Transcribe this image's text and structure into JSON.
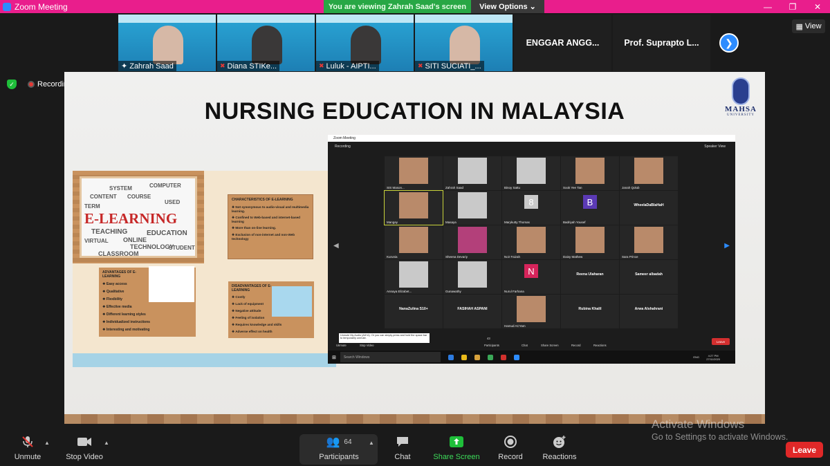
{
  "window": {
    "title": "Zoom Meeting",
    "banner": "You are viewing Zahrah Saad's screen",
    "view_options": "View Options",
    "view_button": "View"
  },
  "thumbnails": [
    {
      "name": "Zahrah Saad",
      "muted": false
    },
    {
      "name": "Diana  STIKe...",
      "muted": true
    },
    {
      "name": "Luluk - AIPTI...",
      "muted": true
    },
    {
      "name": "SITI SUCIATI_...",
      "muted": true
    }
  ],
  "name_tiles": [
    "ENGGAR ANGG...",
    "Prof. Suprapto L..."
  ],
  "recording": "Recording",
  "slide": {
    "title": "NURSING EDUCATION IN MALAYSIA",
    "logo_text": "MAHSA",
    "logo_sub": "UNIVERSITY",
    "elearning": "E-LEARNING",
    "wordcloud_words": [
      "ONLINE",
      "TEACHING",
      "EDUCATION",
      "TECHNOLOGY",
      "CLASSROOM",
      "USED",
      "STUDENT",
      "COURSE",
      "VIRTUAL",
      "SYSTEM",
      "COMPUTER",
      "TERM",
      "CONTENT"
    ],
    "characteristics": {
      "heading": "CHARACTERISTICS OF E-LEARNING",
      "items": [
        "Not synonymous to audio-visual and multimedia learning.",
        "Confined to Web-based and internet-based learning",
        "More than on-line learning.",
        "Exclusion of non-internet and non-Web technology"
      ]
    },
    "advantages": {
      "heading": "ADVANTAGES OF E-LEARNING",
      "items": [
        "Easy access",
        "Qualitative",
        "Flexibility",
        "Effective media",
        "Different learning styles",
        "Individualized instructions",
        "Interesting and motivating"
      ]
    },
    "disadvantages": {
      "heading": "DISADVANTAGES OF E-LEARNING",
      "items": [
        "Costly",
        "Lack of equipment",
        "Negative attitude",
        "Feeling of isolation",
        "Requires knowledge and skills",
        "Adverse effect on health"
      ]
    }
  },
  "inner_zoom": {
    "title": "Zoom Meeting",
    "recording": "Recording",
    "speaker_view": "Speaker View",
    "participants": [
      {
        "name": "SIS Mason...",
        "kind": "video",
        "tone": "warm"
      },
      {
        "name": "Zahrah Saad",
        "kind": "video",
        "tone": "lt"
      },
      {
        "name": "Binoy Sattu",
        "kind": "video",
        "tone": "lt"
      },
      {
        "name": "Sook Yee Tan",
        "kind": "video",
        "tone": "warm"
      },
      {
        "name": "Janah Qolub",
        "kind": "video",
        "tone": "warm"
      },
      {
        "name": "Mangay",
        "kind": "video",
        "tone": "warm",
        "selected": true
      },
      {
        "name": "Masaya",
        "kind": "video",
        "tone": "lt"
      },
      {
        "name": "Marykutty Thomas",
        "kind": "avatar",
        "letter": "8",
        "color": "#c9c9c9"
      },
      {
        "name": "Badriyah Yousef",
        "kind": "avatar",
        "letter": "B",
        "color": "#5b3ab5"
      },
      {
        "name": "WheelaDaBlaHaH",
        "kind": "name"
      },
      {
        "name": "Kurunia",
        "kind": "video",
        "tone": "warm"
      },
      {
        "name": "Sheena Devariy",
        "kind": "video",
        "tone": "mag"
      },
      {
        "name": "Noir Faizah",
        "kind": "video",
        "tone": "warm"
      },
      {
        "name": "Daisy Mathew",
        "kind": "video",
        "tone": "warm"
      },
      {
        "name": "Sara Prince",
        "kind": "video",
        "tone": "warm"
      },
      {
        "name": "Annaya Elizabet...",
        "kind": "video",
        "tone": "lt"
      },
      {
        "name": "Gunawathy",
        "kind": "video",
        "tone": "lt"
      },
      {
        "name": "Nurul Farhana",
        "kind": "avatar",
        "letter": "N",
        "color": "#d6245b"
      },
      {
        "name": "Reena Ulaharan",
        "kind": "name"
      },
      {
        "name": "Sameer albadah",
        "kind": "name"
      },
      {
        "name": "NanaZulina S10+",
        "kind": "name"
      },
      {
        "name": "FASIHAH ASPANI",
        "kind": "name"
      },
      {
        "name": "Hamud ACYam",
        "kind": "video",
        "tone": "warm"
      },
      {
        "name": "Rubina Khalil",
        "kind": "name"
      },
      {
        "name": "Arwa Alshahrani",
        "kind": "name"
      }
    ],
    "tooltip": "Unmute My Audio (Alt+A). Or you can simply press and hold the space bar to temporarily unmute.",
    "controls": [
      "Unmute",
      "Stop Video",
      "Participants",
      "Chat",
      "Share Screen",
      "Record",
      "Reactions"
    ],
    "participants_count": "43",
    "leave": "Leave",
    "taskbar_search": "Search Windows",
    "clock_time": "4:27 PM",
    "clock_date": "27/11/2020",
    "lang": "ENG"
  },
  "toolbar": {
    "unmute": "Unmute",
    "stop_video": "Stop Video",
    "participants": "Participants",
    "participants_count": "64",
    "chat": "Chat",
    "share_screen": "Share Screen",
    "record": "Record",
    "reactions": "Reactions",
    "leave": "Leave"
  },
  "watermark": {
    "line1": "Activate Windows",
    "line2": "Go to Settings to activate Windows."
  }
}
